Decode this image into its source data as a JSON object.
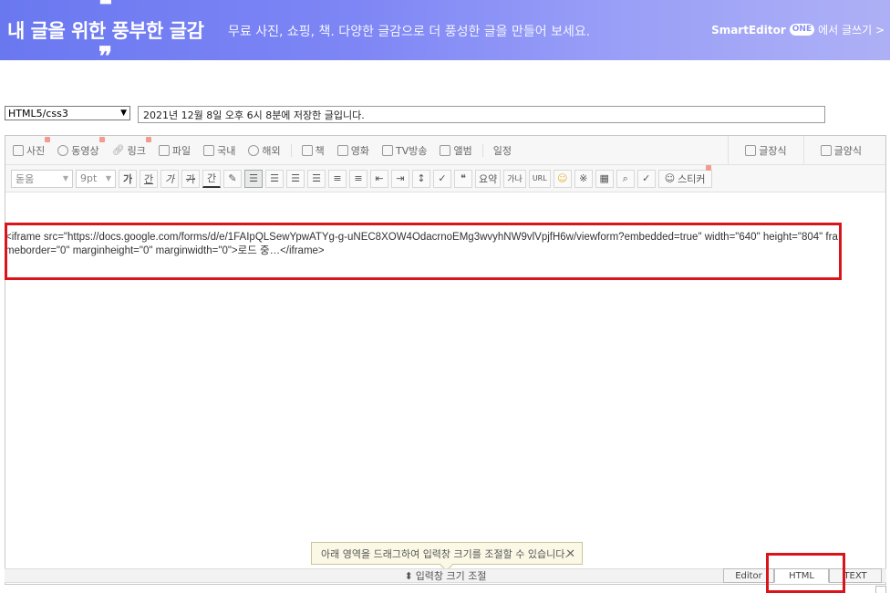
{
  "banner": {
    "title": "내 글을 위한 풍부한 글감",
    "subtitle": "무료 사진, 쇼핑, 책. 다양한 글감으로 더 풍성한 글을 만들어 보세요.",
    "brand_name": "SmartEditor",
    "brand_badge": "ONE",
    "brand_link": "에서 글쓰기 >"
  },
  "post": {
    "category": "HTML5/css3",
    "title": "2021년 12월 8일 오후 6시 8분에 저장한 글입니다."
  },
  "toolbar1": {
    "photo": "사진",
    "video": "동영상",
    "link": "링크",
    "file": "파일",
    "domestic": "국내",
    "overseas": "해외",
    "book": "책",
    "movie": "영화",
    "tv": "TV방송",
    "album": "앨범",
    "schedule": "일정",
    "post_style": "글장식",
    "template": "글양식"
  },
  "toolbar2": {
    "font": "돋움",
    "size": "9pt",
    "bold": "가",
    "underline": "간",
    "italic": "가",
    "strike": "가",
    "font_color": "간",
    "quote": "❝",
    "summary": "요약",
    "hanja": "가나",
    "url": "URL",
    "sticker": "스티커"
  },
  "content": {
    "code": "<iframe src=\"https://docs.google.com/forms/d/e/1FAIpQLSewYpwATYg-g-uNEC8XOW4OdacrnoEMg3wvyhNW9vlVpjfH6w/viewform?embedded=true\" width=\"640\" height=\"804\" frameborder=\"0\" marginheight=\"0\" marginwidth=\"0\">로드 중…</iframe>"
  },
  "tooltip": {
    "text": "아래 영역을 드래그하여 입력창 크기를 조절할 수 있습니다.",
    "close": "✕"
  },
  "resize": {
    "label": "입력창 크기 조절"
  },
  "modes": {
    "editor": "Editor",
    "html": "HTML",
    "text": "TEXT"
  },
  "colors": {
    "highlight": "#d9141a",
    "banner": "#7e86f5"
  }
}
